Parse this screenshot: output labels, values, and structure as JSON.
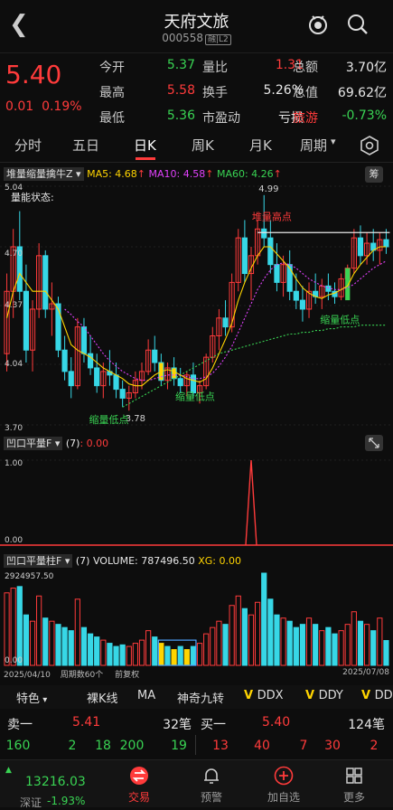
{
  "header": {
    "title": "天府文旅",
    "code": "000558",
    "code_tag": "融|L2"
  },
  "quote": {
    "price": "5.40",
    "change": "0.01",
    "change_pct": "0.19%",
    "rows": [
      [
        {
          "l": "今开",
          "v": "5.37",
          "c": "green"
        },
        {
          "l": "量比",
          "v": "1.31",
          "c": "red"
        },
        {
          "l": "总额",
          "v": "3.70亿",
          "c": "white"
        }
      ],
      [
        {
          "l": "最高",
          "v": "5.58",
          "c": "red"
        },
        {
          "l": "换手",
          "v": "5.26%",
          "c": "white"
        },
        {
          "l": "总值",
          "v": "69.62亿",
          "c": "white"
        }
      ],
      [
        {
          "l": "最低",
          "v": "5.36",
          "c": "green"
        },
        {
          "l": "市盈动",
          "v": "亏损",
          "c": "white"
        },
        {
          "l": "旅游",
          "v": "-0.73%",
          "c": "green"
        }
      ]
    ]
  },
  "tabs": [
    "分时",
    "五日",
    "日K",
    "周K",
    "月K",
    "周期"
  ],
  "main_chart": {
    "indicator_name": "堆量缩量擒牛Z",
    "ma5": "MA5: 4.68",
    "ma10": "MA10: 4.58",
    "ma60": "MA60: 4.26",
    "label_volstate": "量能状态:",
    "y_top": "5.04",
    "y_upper": "4.70",
    "y_mid": "4.37",
    "y_low": "4.04",
    "y_bottom": "3.70",
    "high_label": "4.99",
    "low_label": "3.78",
    "ann_heap": "堆量高点",
    "ann_low1": "缩量低点",
    "ann_low2": "缩量低点",
    "ann_low3": "缩量低点",
    "chou": "筹"
  },
  "ind1": {
    "name": "凹口平量F",
    "param": "(7)",
    "value": ": 0.00",
    "y_top": "1.00",
    "y_bottom": "0.00"
  },
  "ind2": {
    "name": "凹口平量柱F",
    "param": "(7)",
    "volume": "VOLUME: 787496.50",
    "xg": "XG: 0.00",
    "y_top": "2924957.50",
    "y_bottom": "0.00",
    "date_start": "2025/04/10",
    "period": "周期数60个",
    "fq": "前复权",
    "date_end": "2025/07/08"
  },
  "bottom_tabs": [
    "特色",
    "裸K线",
    "MA",
    "神奇九转",
    "DDX",
    "DDY",
    "DD"
  ],
  "orderbook": {
    "sell_label": "卖一",
    "sell_price": "5.41",
    "sell_vol": "32笔",
    "buy_label": "买一",
    "buy_price": "5.40",
    "buy_vol": "124笔",
    "sell_nums": [
      "160",
      "2",
      "18",
      "200",
      "19"
    ],
    "buy_nums": [
      "13",
      "40",
      "7",
      "30",
      "2"
    ]
  },
  "bottom_nav": {
    "index_value": "13216.03",
    "index_name": "深证",
    "index_change": "-1.93%",
    "items": [
      "交易",
      "预警",
      "加自选",
      "更多"
    ]
  },
  "chart_data": {
    "type": "candlestick",
    "title": "",
    "x_range": [
      "2025/04/10",
      "2025/07/08"
    ],
    "ylim": [
      3.7,
      5.04
    ],
    "candles": [
      [
        4.1,
        4.55,
        4.0,
        4.45
      ],
      [
        4.45,
        4.8,
        4.3,
        4.7
      ],
      [
        4.7,
        4.9,
        4.4,
        4.45
      ],
      [
        4.45,
        4.6,
        4.05,
        4.12
      ],
      [
        4.12,
        4.4,
        4.0,
        4.35
      ],
      [
        4.35,
        4.72,
        4.3,
        4.65
      ],
      [
        4.65,
        4.68,
        4.3,
        4.35
      ],
      [
        4.35,
        4.5,
        4.2,
        4.38
      ],
      [
        4.38,
        4.42,
        4.08,
        4.12
      ],
      [
        4.12,
        4.2,
        3.95,
        4.0
      ],
      [
        4.0,
        4.08,
        3.85,
        3.92
      ],
      [
        3.92,
        4.3,
        3.9,
        4.25
      ],
      [
        4.25,
        4.3,
        4.05,
        4.1
      ],
      [
        4.1,
        4.2,
        3.98,
        4.02
      ],
      [
        4.02,
        4.1,
        3.88,
        3.92
      ],
      [
        3.92,
        4.05,
        3.85,
        4.0
      ],
      [
        4.0,
        4.12,
        3.92,
        3.98
      ],
      [
        3.98,
        4.05,
        3.85,
        3.9
      ],
      [
        3.9,
        3.95,
        3.8,
        3.85
      ],
      [
        3.85,
        3.92,
        3.78,
        3.88
      ],
      [
        3.88,
        4.0,
        3.85,
        3.95
      ],
      [
        3.95,
        4.05,
        3.9,
        4.0
      ],
      [
        4.0,
        4.18,
        3.98,
        4.12
      ],
      [
        4.12,
        4.2,
        4.0,
        4.05
      ],
      [
        4.05,
        4.1,
        3.92,
        3.95
      ],
      [
        3.95,
        4.05,
        3.9,
        4.02
      ],
      [
        4.02,
        4.08,
        3.92,
        3.96
      ],
      [
        3.96,
        4.02,
        3.88,
        3.92
      ],
      [
        3.92,
        4.0,
        3.86,
        3.98
      ],
      [
        3.98,
        4.05,
        3.85,
        3.88
      ],
      [
        3.88,
        3.95,
        3.82,
        3.92
      ],
      [
        3.92,
        4.1,
        3.9,
        4.08
      ],
      [
        4.08,
        4.25,
        4.05,
        4.2
      ],
      [
        4.2,
        4.35,
        4.12,
        4.3
      ],
      [
        4.3,
        4.4,
        4.2,
        4.25
      ],
      [
        4.25,
        4.55,
        4.22,
        4.5
      ],
      [
        4.5,
        4.8,
        4.45,
        4.75
      ],
      [
        4.75,
        4.85,
        4.5,
        4.55
      ],
      [
        4.55,
        4.7,
        4.4,
        4.65
      ],
      [
        4.65,
        4.85,
        4.6,
        4.8
      ],
      [
        4.8,
        4.99,
        4.7,
        4.75
      ],
      [
        4.75,
        4.85,
        4.55,
        4.6
      ],
      [
        4.6,
        4.72,
        4.45,
        4.5
      ],
      [
        4.5,
        4.65,
        4.42,
        4.6
      ],
      [
        4.6,
        4.68,
        4.4,
        4.45
      ],
      [
        4.45,
        4.55,
        4.35,
        4.4
      ],
      [
        4.4,
        4.48,
        4.28,
        4.35
      ],
      [
        4.35,
        4.5,
        4.3,
        4.45
      ],
      [
        4.45,
        4.55,
        4.38,
        4.42
      ],
      [
        4.42,
        4.52,
        4.35,
        4.48
      ],
      [
        4.48,
        4.55,
        4.4,
        4.45
      ],
      [
        4.45,
        4.5,
        4.38,
        4.42
      ],
      [
        4.42,
        4.55,
        4.4,
        4.52
      ],
      [
        4.52,
        4.6,
        4.45,
        4.58
      ],
      [
        4.58,
        4.8,
        4.55,
        4.75
      ],
      [
        4.75,
        4.82,
        4.6,
        4.65
      ],
      [
        4.65,
        4.78,
        4.6,
        4.72
      ],
      [
        4.72,
        4.8,
        4.62,
        4.68
      ],
      [
        4.68,
        4.78,
        4.6,
        4.74
      ],
      [
        4.74,
        4.8,
        4.66,
        4.7
      ]
    ],
    "ma5": [
      4.3,
      4.45,
      4.55,
      4.5,
      4.45,
      4.45,
      4.45,
      4.4,
      4.35,
      4.25,
      4.15,
      4.12,
      4.1,
      4.08,
      4.05,
      4.02,
      4.0,
      3.98,
      3.96,
      3.93,
      3.92,
      3.92,
      3.95,
      3.98,
      4.0,
      4.01,
      4.0,
      3.98,
      3.96,
      3.95,
      3.94,
      3.96,
      4.02,
      4.1,
      4.18,
      4.27,
      4.4,
      4.5,
      4.58,
      4.65,
      4.7,
      4.7,
      4.66,
      4.62,
      4.58,
      4.52,
      4.47,
      4.44,
      4.42,
      4.41,
      4.43,
      4.44,
      4.46,
      4.48,
      4.55,
      4.6,
      4.64,
      4.68,
      4.7,
      4.7
    ],
    "ma10": [
      null,
      null,
      null,
      null,
      null,
      null,
      null,
      null,
      null,
      4.35,
      4.32,
      4.28,
      4.25,
      4.2,
      4.15,
      4.1,
      4.06,
      4.03,
      4.0,
      3.98,
      3.96,
      3.95,
      3.95,
      3.96,
      3.97,
      3.98,
      3.98,
      3.98,
      3.97,
      3.96,
      3.96,
      3.97,
      3.99,
      4.03,
      4.08,
      4.14,
      4.22,
      4.3,
      4.38,
      4.46,
      4.52,
      4.57,
      4.6,
      4.61,
      4.6,
      4.58,
      4.55,
      4.52,
      4.5,
      4.48,
      4.47,
      4.46,
      4.46,
      4.47,
      4.49,
      4.52,
      4.55,
      4.58,
      4.6,
      4.62
    ],
    "ma60": [
      null,
      null,
      null,
      null,
      null,
      null,
      null,
      null,
      null,
      null,
      null,
      null,
      null,
      null,
      null,
      null,
      null,
      null,
      3.8,
      3.82,
      3.84,
      3.86,
      3.88,
      3.9,
      3.92,
      3.94,
      3.96,
      3.98,
      4.0,
      4.02,
      4.04,
      4.06,
      4.08,
      4.1,
      4.11,
      4.12,
      4.13,
      4.14,
      4.15,
      4.16,
      4.17,
      4.18,
      4.19,
      4.2,
      4.21,
      4.21,
      4.22,
      4.22,
      4.23,
      4.23,
      4.24,
      4.24,
      4.25,
      4.25,
      4.25,
      4.26,
      4.26,
      4.26,
      4.26,
      4.26
    ],
    "signal_spike_index": 40,
    "volume": [
      2300000,
      2450000,
      2500000,
      1600000,
      1400000,
      2200000,
      1500000,
      1400000,
      1300000,
      1200000,
      1100000,
      2100000,
      1200000,
      1000000,
      900000,
      800000,
      700000,
      600000,
      650000,
      600000,
      700000,
      800000,
      1100000,
      900000,
      700000,
      600000,
      500000,
      600000,
      500000,
      600000,
      700000,
      1000000,
      1200000,
      1400000,
      1300000,
      1900000,
      2200000,
      1800000,
      1600000,
      2000000,
      2924957,
      2100000,
      1600000,
      1500000,
      1400000,
      1200000,
      1300000,
      1500000,
      1300000,
      1100000,
      1200000,
      1000000,
      1100000,
      1300000,
      1700000,
      1400000,
      1300000,
      1100000,
      1500000,
      787496.5
    ],
    "flat_box_range": [
      24,
      29
    ]
  }
}
